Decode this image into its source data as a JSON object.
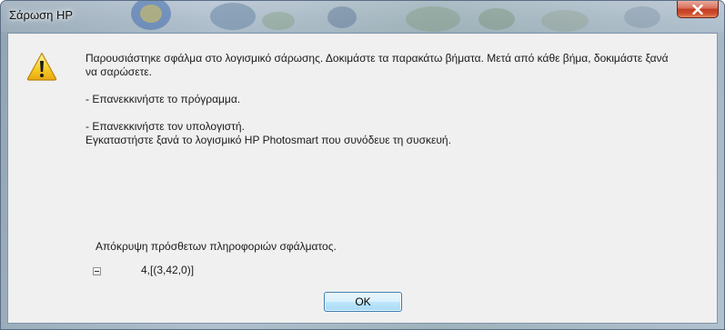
{
  "window": {
    "title": "Σάρωση HP"
  },
  "title_controls": {
    "close_icon": "close-icon"
  },
  "message": {
    "icon": "warning-icon",
    "line1": "Παρουσιάστηκε σφάλμα στο λογισμικό σάρωσης.  Δοκιμάστε τα παρακάτω βήματα.  Μετά από κάθε βήμα, δοκιμάστε ξανά",
    "line2": "να σαρώσετε.",
    "step1": "- Επανεκκινήστε το πρόγραμμα.",
    "step2": "- Επανεκκινήστε τον υπολογιστή.",
    "step3": "Εγκαταστήστε ξανά το λογισμικό HP Photosmart που συνόδευε τη συσκευή."
  },
  "details": {
    "toggle_label": "Απόκρυψη πρόσθετων πληροφοριών σφάλματος.",
    "collapse_icon": "minus-box-icon",
    "error_code": "4,[(3,42,0)]"
  },
  "buttons": {
    "ok_label": "OK"
  }
}
